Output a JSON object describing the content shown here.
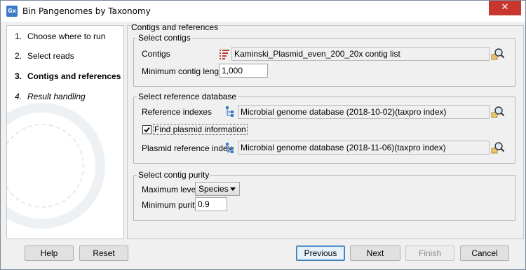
{
  "window": {
    "title": "Bin Pangenomes by Taxonomy",
    "app_icon": "Gx",
    "close": "✕"
  },
  "steps": [
    {
      "num": "1.",
      "label": "Choose where to run",
      "state": "done"
    },
    {
      "num": "2.",
      "label": "Select reads",
      "state": "done"
    },
    {
      "num": "3.",
      "label": "Contigs and references",
      "state": "active"
    },
    {
      "num": "4.",
      "label": "Result handling",
      "state": "future"
    }
  ],
  "panel": {
    "title": "Contigs and references"
  },
  "select_contigs": {
    "legend": "Select contigs",
    "contigs_label": "Contigs",
    "contigs_value": "Kaminski_Plasmid_even_200_20x contig list",
    "min_length_label": "Minimum contig length",
    "min_length_value": "1,000"
  },
  "reference_db": {
    "legend": "Select reference database",
    "indexes_label": "Reference indexes",
    "indexes_value": "Microbial genome database (2018-10-02)(taxpro index)",
    "find_plasmid_label": "Find plasmid information",
    "find_plasmid_checked": true,
    "plasmid_label": "Plasmid reference index",
    "plasmid_value": "Microbial genome database (2018-11-06)(taxpro index)"
  },
  "purity": {
    "legend": "Select contig purity",
    "max_level_label": "Maximum level",
    "max_level_value": "Species",
    "min_purity_label": "Minimum purity",
    "min_purity_value": "0.9"
  },
  "buttons": {
    "help": "Help",
    "reset": "Reset",
    "previous": "Previous",
    "next": "Next",
    "finish": "Finish",
    "cancel": "Cancel"
  },
  "icons": {
    "contig_list": "contig-list-icon",
    "taxpro_index": "taxonomy-index-icon",
    "browse": "browse-magnifier-icon"
  }
}
